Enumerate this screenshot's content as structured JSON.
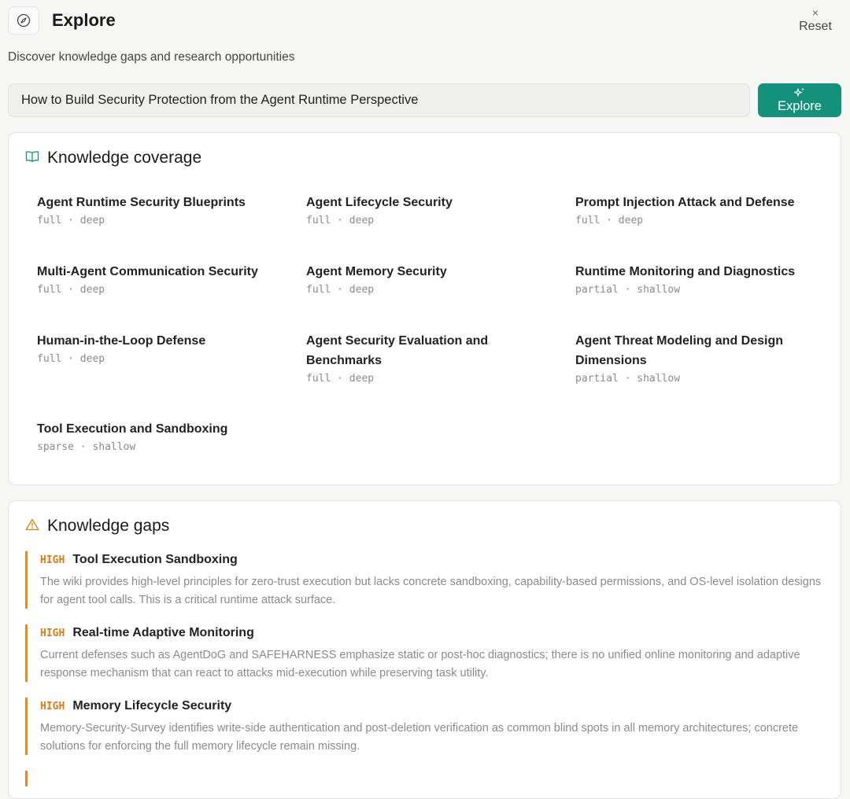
{
  "header": {
    "title": "Explore",
    "reset_label": "Reset",
    "reset_icon": "×",
    "subtitle": "Discover knowledge gaps and research opportunities"
  },
  "search": {
    "value": "How to Build Security Protection from the Agent Runtime Perspective",
    "button_label": "Explore",
    "button_icon": "sparkles-icon",
    "accent_color": "#14917a"
  },
  "coverage": {
    "title": "Knowledge coverage",
    "icon": "book-open-icon",
    "items": [
      {
        "name": "Agent Runtime Security Blueprints",
        "meta": "full · deep"
      },
      {
        "name": "Agent Lifecycle Security",
        "meta": "full · deep"
      },
      {
        "name": "Prompt Injection Attack and Defense",
        "meta": "full · deep"
      },
      {
        "name": "Multi-Agent Communication Security",
        "meta": "full · deep"
      },
      {
        "name": "Agent Memory Security",
        "meta": "full · deep"
      },
      {
        "name": "Runtime Monitoring and Diagnostics",
        "meta": "partial · shallow"
      },
      {
        "name": "Human-in-the-Loop Defense",
        "meta": "full · deep"
      },
      {
        "name": "Agent Security Evaluation and Benchmarks",
        "meta": "full · deep"
      },
      {
        "name": "Agent Threat Modeling and Design Dimensions",
        "meta": "partial · shallow"
      },
      {
        "name": "Tool Execution and Sandboxing",
        "meta": "sparse · shallow"
      }
    ]
  },
  "gaps": {
    "title": "Knowledge gaps",
    "icon": "warning-triangle-icon",
    "severity_color": "#e07b12",
    "items": [
      {
        "severity": "HIGH",
        "title": "Tool Execution Sandboxing",
        "description": "The wiki provides high-level principles for zero-trust execution but lacks concrete sandboxing, capability-based permissions, and OS-level isolation designs for agent tool calls. This is a critical runtime attack surface."
      },
      {
        "severity": "HIGH",
        "title": "Real-time Adaptive Monitoring",
        "description": "Current defenses such as AgentDoG and SAFEHARNESS emphasize static or post-hoc diagnostics; there is no unified online monitoring and adaptive response mechanism that can react to attacks mid-execution while preserving task utility."
      },
      {
        "severity": "HIGH",
        "title": "Memory Lifecycle Security",
        "description": "Memory-Security-Survey identifies write-side authentication and post-deletion verification as common blind spots in all memory architectures; concrete solutions for enforcing the full memory lifecycle remain missing."
      }
    ]
  }
}
